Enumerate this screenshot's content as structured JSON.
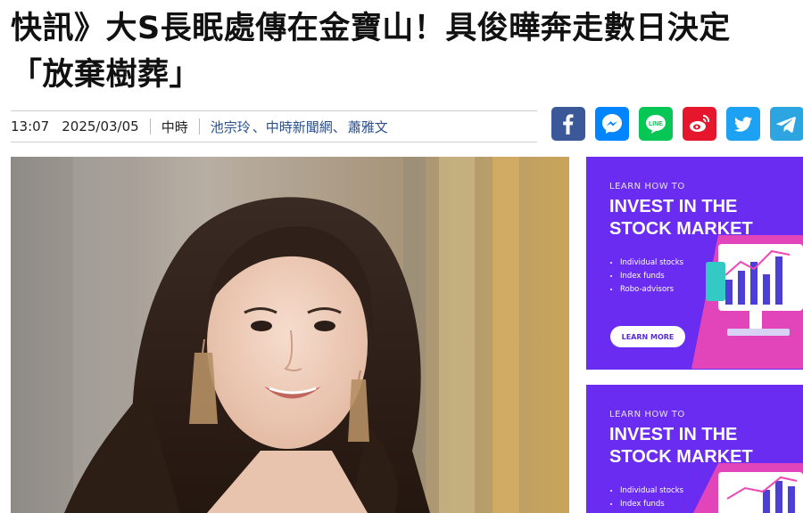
{
  "article": {
    "headline_line1": "快訊》大S長眠處傳在金寶山！具俊曄奔走數日決定",
    "headline_line2": "「放棄樹葬」"
  },
  "meta": {
    "time": "13:07",
    "date": "2025/03/05",
    "source": "中時",
    "authors": [
      "池宗玲",
      "、中時新聞網、",
      "蕭雅文"
    ]
  },
  "share": [
    {
      "name": "facebook-icon",
      "color": "#3b5998"
    },
    {
      "name": "messenger-icon",
      "color": "#0084ff"
    },
    {
      "name": "line-icon",
      "color": "#06c755",
      "text": "LINE"
    },
    {
      "name": "weibo-icon",
      "color": "#e6162d"
    },
    {
      "name": "twitter-icon",
      "color": "#1da1f2"
    },
    {
      "name": "telegram-icon",
      "color": "#2ca5e0"
    }
  ],
  "ads": [
    {
      "eyebrow": "LEARN HOW TO",
      "title_line1": "INVEST IN THE",
      "title_line2": "STOCK MARKET",
      "bullets": [
        "Individual stocks",
        "Index funds",
        "Robo-advisors"
      ],
      "cta": "LEARN MORE"
    },
    {
      "eyebrow": "LEARN HOW TO",
      "title_line1": "INVEST IN THE",
      "title_line2": "STOCK MARKET",
      "bullets": [
        "Individual stocks",
        "Index funds"
      ]
    }
  ]
}
